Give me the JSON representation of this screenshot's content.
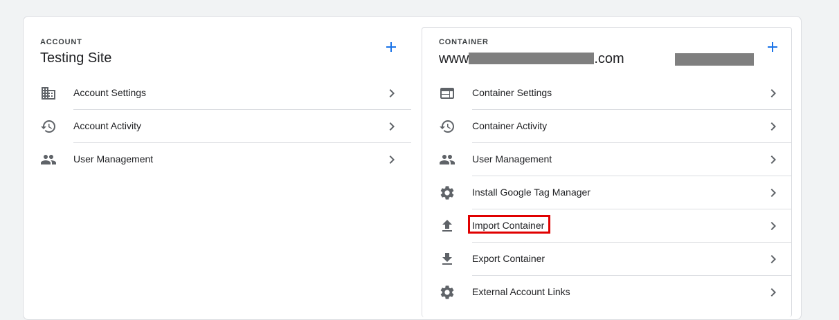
{
  "account": {
    "section_label": "ACCOUNT",
    "title": "Testing Site",
    "add_icon": "add-icon",
    "items": [
      {
        "label": "Account Settings",
        "icon": "domain-icon"
      },
      {
        "label": "Account Activity",
        "icon": "history-icon"
      },
      {
        "label": "User Management",
        "icon": "people-icon"
      }
    ]
  },
  "container": {
    "section_label": "CONTAINER",
    "title_prefix": "www",
    "title_suffix": ".com",
    "add_icon": "add-icon",
    "items": [
      {
        "label": "Container Settings",
        "icon": "web-icon"
      },
      {
        "label": "Container Activity",
        "icon": "history-icon"
      },
      {
        "label": "User Management",
        "icon": "people-icon"
      },
      {
        "label": "Install Google Tag Manager",
        "icon": "gear-icon"
      },
      {
        "label": "Import Container",
        "icon": "upload-icon",
        "highlighted": true
      },
      {
        "label": "Export Container",
        "icon": "download-icon"
      },
      {
        "label": "External Account Links",
        "icon": "gear-icon"
      }
    ]
  },
  "colors": {
    "accent": "#1a73e8",
    "highlight_border": "#e00000",
    "icon": "#5f6368",
    "redaction": "#7f7f7f"
  }
}
